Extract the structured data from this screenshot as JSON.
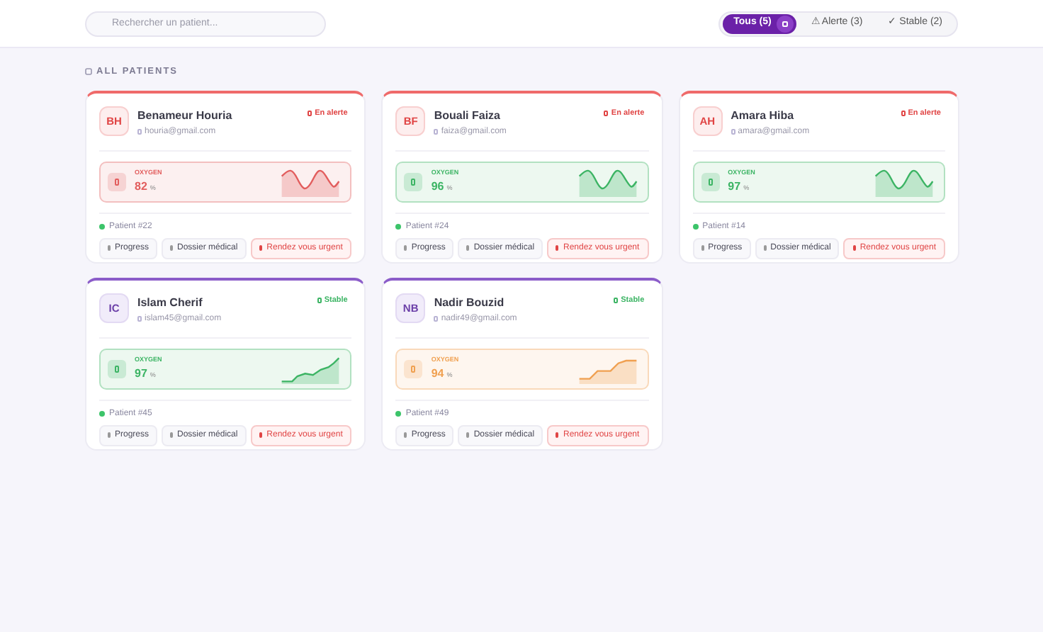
{
  "search": {
    "placeholder": "Rechercher un patient..."
  },
  "filters": [
    {
      "label": "Tous (5)",
      "selected": true
    },
    {
      "label": "⚠ Alerte (3)",
      "selected": false
    },
    {
      "label": "✓ Stable (2)",
      "selected": false
    }
  ],
  "section_title": "ALL PATIENTS",
  "patients": [
    {
      "initials": "BH",
      "name": "Benameur Houria",
      "email": "houria@gmail.com",
      "alert": true,
      "badge": "En alerte",
      "oxygen": {
        "label": "OXYGEN",
        "value": "82",
        "unit": "%",
        "color": "#e25d5d",
        "kind": "wave"
      },
      "patient_id": "Patient #22",
      "actions": [
        "Progress",
        "Dossier médical",
        "Rendez vous urgent"
      ]
    },
    {
      "initials": "BF",
      "name": "Bouali Faiza",
      "email": "faiza@gmail.com",
      "alert": true,
      "badge": "En alerte",
      "oxygen": {
        "label": "OXYGEN",
        "value": "96",
        "unit": "%",
        "color": "#3cb464",
        "kind": "wave"
      },
      "patient_id": "Patient #24",
      "actions": [
        "Progress",
        "Dossier médical",
        "Rendez vous urgent"
      ]
    },
    {
      "initials": "AH",
      "name": "Amara Hiba",
      "email": "amara@gmail.com",
      "alert": true,
      "badge": "En alerte",
      "oxygen": {
        "label": "OXYGEN",
        "value": "97",
        "unit": "%",
        "color": "#3cb464",
        "kind": "wave"
      },
      "patient_id": "Patient #14",
      "actions": [
        "Progress",
        "Dossier médical",
        "Rendez vous urgent"
      ]
    },
    {
      "initials": "IC",
      "name": "Islam Cherif",
      "email": "islam45@gmail.com",
      "alert": false,
      "badge": "Stable",
      "oxygen": {
        "label": "OXYGEN",
        "value": "97",
        "unit": "%",
        "color": "#3cb464",
        "kind": "rising"
      },
      "patient_id": "Patient #45",
      "actions": [
        "Progress",
        "Dossier médical",
        "Rendez vous urgent"
      ]
    },
    {
      "initials": "NB",
      "name": "Nadir Bouzid",
      "email": "nadir49@gmail.com",
      "alert": false,
      "badge": "Stable",
      "oxygen": {
        "label": "OXYGEN",
        "value": "94",
        "unit": "%",
        "color": "#f0a050",
        "kind": "steps"
      },
      "patient_id": "Patient #49",
      "actions": [
        "Progress",
        "Dossier médical",
        "Rendez vous urgent"
      ]
    }
  ]
}
